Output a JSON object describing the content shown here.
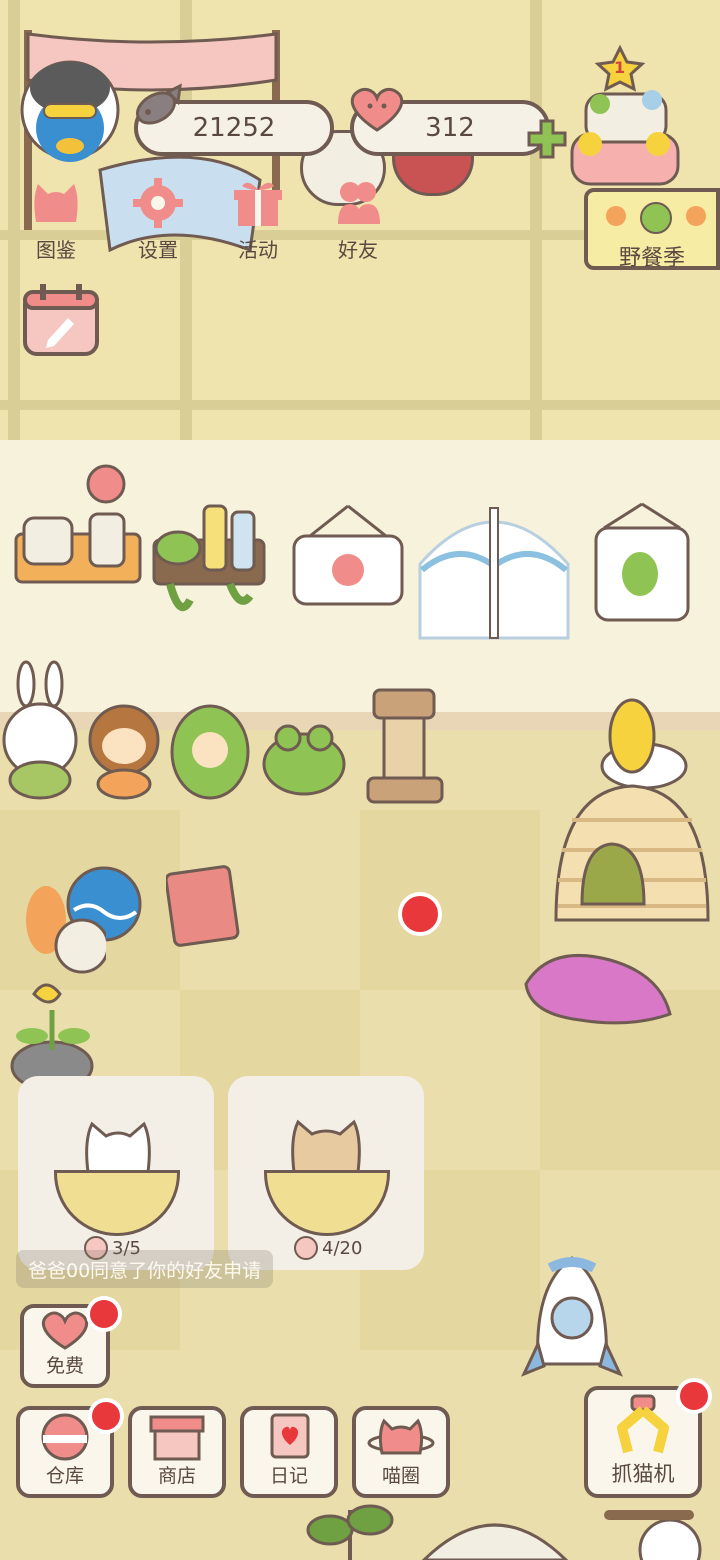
{
  "currency": {
    "fish": "21252",
    "hearts": "312",
    "add_symbol": "+"
  },
  "top_menu": [
    {
      "label": "图鉴",
      "icon": "cat-head-icon"
    },
    {
      "label": "设置",
      "icon": "gear-icon"
    },
    {
      "label": "活动",
      "icon": "gift-icon"
    },
    {
      "label": "好友",
      "icon": "friends-icon"
    }
  ],
  "event": {
    "label": "野餐季",
    "badge": "1"
  },
  "cat_cards": [
    {
      "count": "3/5"
    },
    {
      "count": "4/20"
    }
  ],
  "notification": "爸爸00同意了你的好友申请",
  "free_button": "免费",
  "bottom_bar": [
    {
      "label": "仓库",
      "icon": "storage-icon"
    },
    {
      "label": "商店",
      "icon": "shop-icon"
    },
    {
      "label": "日记",
      "icon": "diary-icon"
    },
    {
      "label": "喵圈",
      "icon": "cat-planet-icon"
    }
  ],
  "claw_machine": "抓猫机",
  "colors": {
    "accent_red": "#e8383b",
    "pink": "#f08d8a",
    "outline": "#6f5b51",
    "green_plus": "#8fc454"
  }
}
